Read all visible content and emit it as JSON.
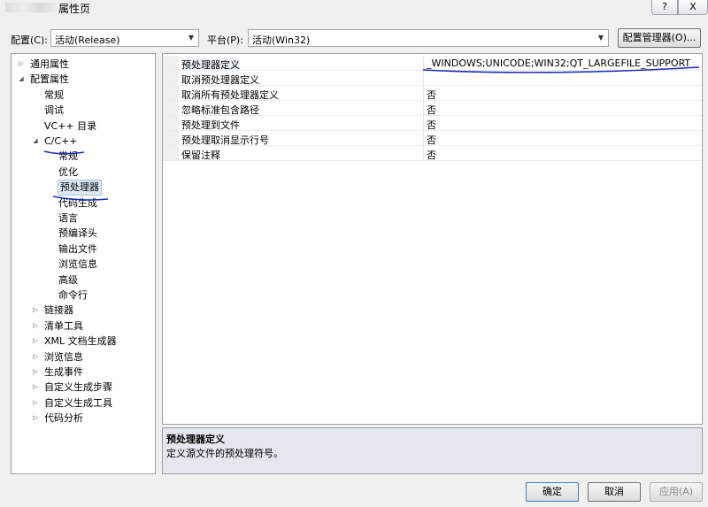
{
  "window": {
    "title": "属性页",
    "help_button": "?",
    "close_button": "X"
  },
  "config_bar": {
    "config_label": "配置(C):",
    "config_value": "活动(Release)",
    "platform_label": "平台(P):",
    "platform_value": "活动(Win32)",
    "manager_button": "配置管理器(O)..."
  },
  "tree": [
    {
      "label": "通用属性",
      "level": 0,
      "expander": "▷"
    },
    {
      "label": "配置属性",
      "level": 0,
      "expander": "◢"
    },
    {
      "label": "常规",
      "level": 1,
      "expander": ""
    },
    {
      "label": "调试",
      "level": 1,
      "expander": ""
    },
    {
      "label": "VC++ 目录",
      "level": 1,
      "expander": ""
    },
    {
      "label": "C/C++",
      "level": 1,
      "expander": "◢"
    },
    {
      "label": "常规",
      "level": 2,
      "expander": ""
    },
    {
      "label": "优化",
      "level": 2,
      "expander": ""
    },
    {
      "label": "预处理器",
      "level": 2,
      "expander": "",
      "selected": true
    },
    {
      "label": "代码生成",
      "level": 2,
      "expander": ""
    },
    {
      "label": "语言",
      "level": 2,
      "expander": ""
    },
    {
      "label": "预编译头",
      "level": 2,
      "expander": ""
    },
    {
      "label": "输出文件",
      "level": 2,
      "expander": ""
    },
    {
      "label": "浏览信息",
      "level": 2,
      "expander": ""
    },
    {
      "label": "高级",
      "level": 2,
      "expander": ""
    },
    {
      "label": "命令行",
      "level": 2,
      "expander": ""
    },
    {
      "label": "链接器",
      "level": 1,
      "expander": "▷"
    },
    {
      "label": "清单工具",
      "level": 1,
      "expander": "▷"
    },
    {
      "label": "XML 文档生成器",
      "level": 1,
      "expander": "▷"
    },
    {
      "label": "浏览信息",
      "level": 1,
      "expander": "▷"
    },
    {
      "label": "生成事件",
      "level": 1,
      "expander": "▷"
    },
    {
      "label": "自定义生成步骤",
      "level": 1,
      "expander": "▷"
    },
    {
      "label": "自定义生成工具",
      "level": 1,
      "expander": "▷"
    },
    {
      "label": "代码分析",
      "level": 1,
      "expander": "▷"
    }
  ],
  "properties": [
    {
      "name": "预处理器定义",
      "value": "_WINDOWS;UNICODE;WIN32;QT_LARGEFILE_SUPPORT"
    },
    {
      "name": "取消预处理器定义",
      "value": ""
    },
    {
      "name": "取消所有预处理器定义",
      "value": "否"
    },
    {
      "name": "忽略标准包含路径",
      "value": "否"
    },
    {
      "name": "预处理到文件",
      "value": "否"
    },
    {
      "name": "预处理取消显示行号",
      "value": "否"
    },
    {
      "name": "保留注释",
      "value": "否"
    }
  ],
  "description": {
    "title": "预处理器定义",
    "text": "定义源文件的预处理符号。"
  },
  "footer": {
    "ok": "确定",
    "cancel": "取消",
    "apply": "应用(A)"
  },
  "colors": {
    "annotation_ink": "#1a2bb8",
    "selection": "#dde8f5",
    "desc_bg": "#e4e8ee"
  }
}
